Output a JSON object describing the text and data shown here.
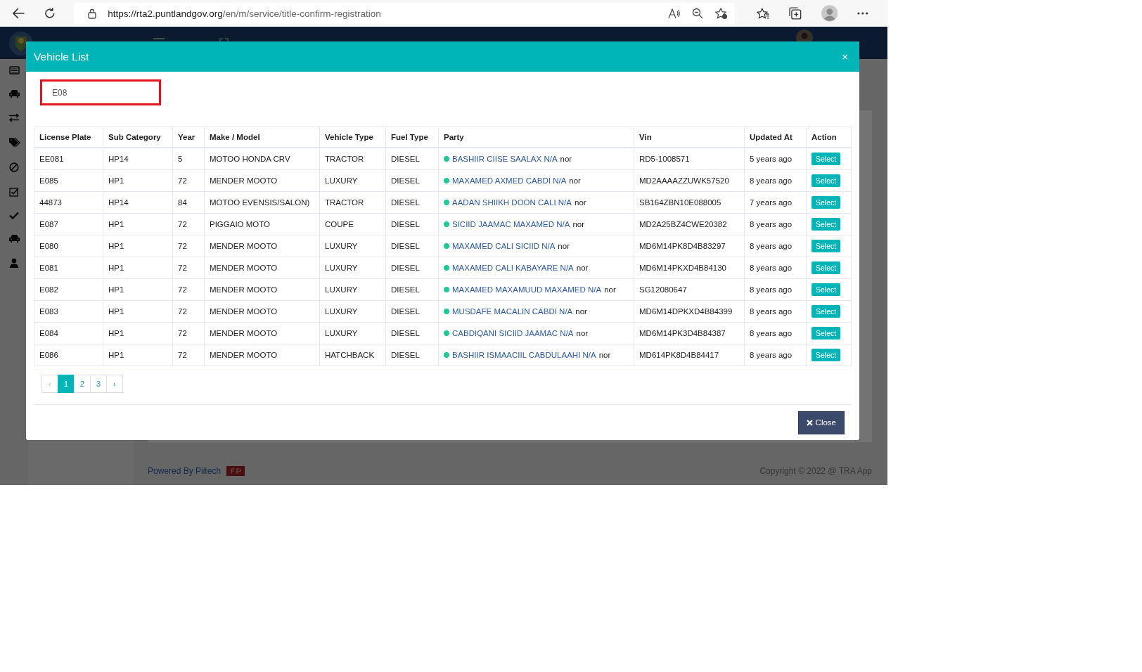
{
  "browser": {
    "url_host": "https://rta2.puntlandgov.org",
    "url_path": "/en/m/service/title-confirm-registration"
  },
  "modal": {
    "title": "Vehicle List",
    "close": "×",
    "search": {
      "value": "E08"
    },
    "table": {
      "columns": [
        "License Plate",
        "Sub Category",
        "Year",
        "Make / Model",
        "Vehicle Type",
        "Fuel Type",
        "Party",
        "Vin",
        "Updated At",
        "Action"
      ],
      "rows": [
        {
          "plate": "EE081",
          "sub_category": "HP14",
          "year": "5",
          "make_model": "MOTOO HONDA CRV",
          "vehicle_type": "TRACTOR",
          "fuel_type": "DIESEL",
          "party": "BASHIIR CIISE SAALAX N/A",
          "party_note": "nor",
          "vin": "RD5-1008571",
          "updated_at": "5 years ago",
          "action": "Select"
        },
        {
          "plate": "E085",
          "sub_category": "HP1",
          "year": "72",
          "make_model": "MENDER MOOTO",
          "vehicle_type": "LUXURY",
          "fuel_type": "DIESEL",
          "party": "MAXAMED AXMED CABDI N/A",
          "party_note": "nor",
          "vin": "MD2AAAAZZUWK57520",
          "updated_at": "8 years ago",
          "action": "Select"
        },
        {
          "plate": "44873",
          "sub_category": "HP14",
          "year": "84",
          "make_model": "MOTOO EVENSIS/SALON)",
          "vehicle_type": "TRACTOR",
          "fuel_type": "DIESEL",
          "party": "AADAN SHIIKH DOON CALI N/A",
          "party_note": "nor",
          "vin": "SB164ZBN10E088005",
          "updated_at": "7 years ago",
          "action": "Select"
        },
        {
          "plate": "E087",
          "sub_category": "HP1",
          "year": "72",
          "make_model": "PIGGAIO MOTO",
          "vehicle_type": "COUPE",
          "fuel_type": "DIESEL",
          "party": "SICIID JAAMAC MAXAMED N/A",
          "party_note": "nor",
          "vin": "MD2A25BZ4CWE20382",
          "updated_at": "8 years ago",
          "action": "Select"
        },
        {
          "plate": "E080",
          "sub_category": "HP1",
          "year": "72",
          "make_model": "MENDER MOOTO",
          "vehicle_type": "LUXURY",
          "fuel_type": "DIESEL",
          "party": "MAXAMED CALI SICIID N/A",
          "party_note": "nor",
          "vin": "MD6M14PK8D4B83297",
          "updated_at": "8 years ago",
          "action": "Select"
        },
        {
          "plate": "E081",
          "sub_category": "HP1",
          "year": "72",
          "make_model": "MENDER MOOTO",
          "vehicle_type": "LUXURY",
          "fuel_type": "DIESEL",
          "party": "MAXAMED CALI KABAYARE N/A",
          "party_note": "nor",
          "vin": "MD6M14PKXD4B84130",
          "updated_at": "8 years ago",
          "action": "Select"
        },
        {
          "plate": "E082",
          "sub_category": "HP1",
          "year": "72",
          "make_model": "MENDER MOOTO",
          "vehicle_type": "LUXURY",
          "fuel_type": "DIESEL",
          "party": "MAXAMED MAXAMUUD MAXAMED N/A",
          "party_note": "nor",
          "vin": "SG12080647",
          "updated_at": "8 years ago",
          "action": "Select"
        },
        {
          "plate": "E083",
          "sub_category": "HP1",
          "year": "72",
          "make_model": "MENDER MOOTO",
          "vehicle_type": "LUXURY",
          "fuel_type": "DIESEL",
          "party": "MUSDAFE MACALIN CABDI N/A",
          "party_note": "nor",
          "vin": "MD6M14DPKXD4B84399",
          "updated_at": "8 years ago",
          "action": "Select"
        },
        {
          "plate": "E084",
          "sub_category": "HP1",
          "year": "72",
          "make_model": "MENDER MOOTO",
          "vehicle_type": "LUXURY",
          "fuel_type": "DIESEL",
          "party": "CABDIQANI SICIID JAAMAC N/A",
          "party_note": "nor",
          "vin": "MD6M14PK3D4B84387",
          "updated_at": "8 years ago",
          "action": "Select"
        },
        {
          "plate": "E086",
          "sub_category": "HP1",
          "year": "72",
          "make_model": "MENDER MOOTO",
          "vehicle_type": "HATCHBACK",
          "fuel_type": "DIESEL",
          "party": "BASHIIR ISMAACIIL CABDULAAHI N/A",
          "party_note": "nor",
          "vin": "MD614PK8D4B84417",
          "updated_at": "8 years ago",
          "action": "Select"
        }
      ]
    },
    "pagination": {
      "prev": "‹",
      "pages": [
        {
          "label": "1",
          "selected": true
        },
        {
          "label": "2",
          "selected": false
        },
        {
          "label": "3",
          "selected": false
        }
      ],
      "next": "›"
    },
    "close_button": "Close"
  },
  "footer": {
    "powered_by": "Powered By Piitech",
    "copyright": "Copyright © 2022 @ TRA App"
  }
}
